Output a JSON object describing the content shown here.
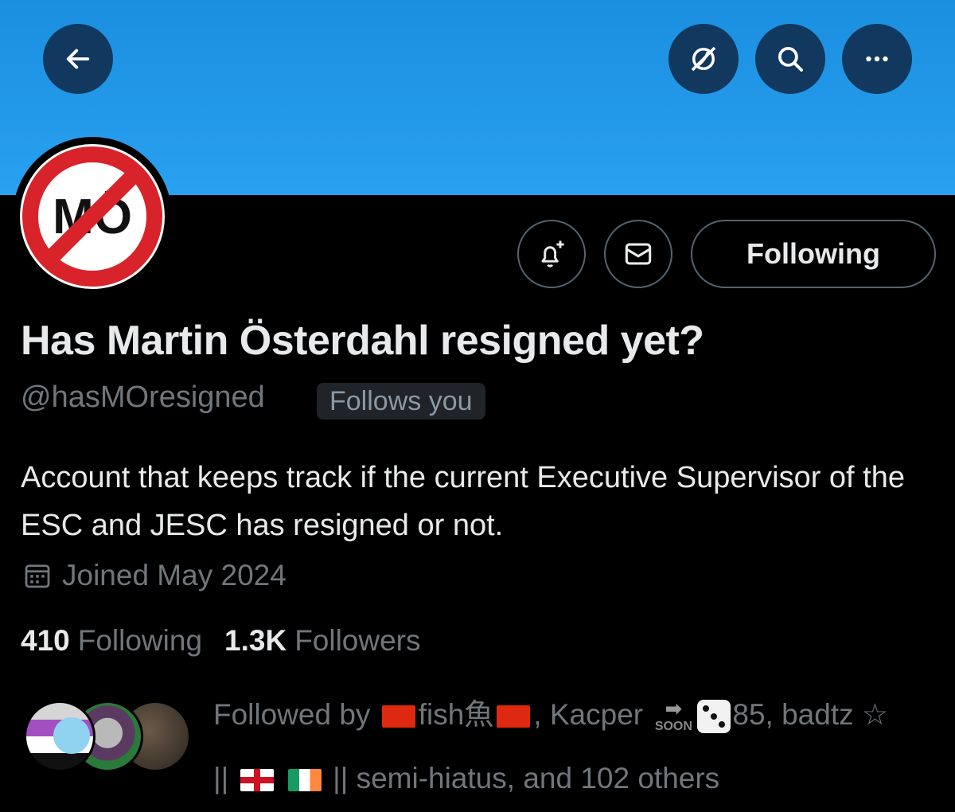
{
  "header": {
    "back_icon": "arrow-left-icon",
    "translate_icon": "globe-slash-icon",
    "search_icon": "search-icon",
    "more_icon": "more-horizontal-icon",
    "banner_color": "#1d9bf0"
  },
  "avatar": {
    "text": "MÖ",
    "ring_color": "#d8232a"
  },
  "actions": {
    "notify_icon": "bell-plus-icon",
    "message_icon": "envelope-icon",
    "following_label": "Following"
  },
  "profile": {
    "display_name": "Has Martin Österdahl resigned yet?",
    "handle": "@hasMOresigned",
    "follows_you": "Follows you",
    "bio": "Account that keeps track if the current Executive Supervisor of the ESC and JESC has resigned or not.",
    "joined": "Joined May 2024",
    "following_count": "410",
    "following_label": "Following",
    "followers_count": "1.3K",
    "followers_label": "Followers"
  },
  "followed_by": {
    "prefix": "Followed by",
    "name1": "fish魚",
    "name2_part1": "Kacper",
    "name2_part2": "85",
    "name3_part1": "badtz ☆",
    "name3_part2": "||",
    "name3_part3": "|| semi-hiatus",
    "suffix": ", and 102 others",
    "comma": ","
  }
}
